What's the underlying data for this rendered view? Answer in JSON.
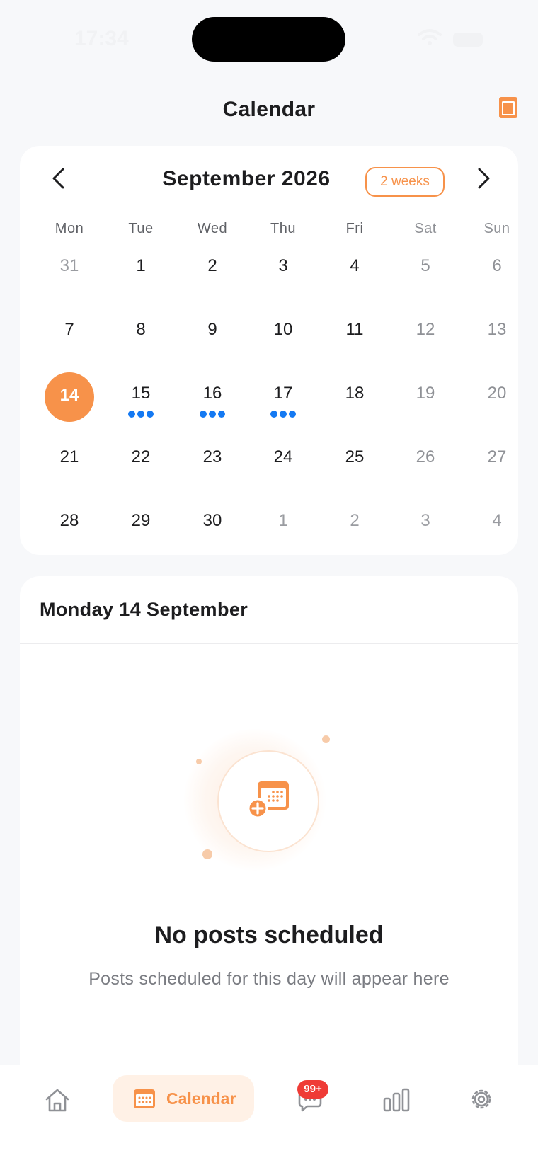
{
  "status_bar": {
    "time": "17:34"
  },
  "header": {
    "title": "Calendar",
    "action_icon": "calendar-view-icon"
  },
  "calendar": {
    "month_title": "September 2026",
    "range_label": "2 weeks",
    "weekdays": [
      "Mon",
      "Tue",
      "Wed",
      "Thu",
      "Fri",
      "Sat",
      "Sun"
    ],
    "weeks": [
      [
        "31",
        "1",
        "2",
        "3",
        "4",
        "5",
        "6"
      ],
      [
        "7",
        "8",
        "9",
        "10",
        "11",
        "12",
        "13"
      ],
      [
        "14",
        "15",
        "16",
        "17",
        "18",
        "19",
        "20"
      ],
      [
        "21",
        "22",
        "23",
        "24",
        "25",
        "26",
        "27"
      ],
      [
        "28",
        "29",
        "30",
        "1",
        "2",
        "3",
        "4"
      ]
    ],
    "selected_day": "14",
    "days_with_posts": [
      "15",
      "16",
      "17"
    ],
    "accent_color": "#f7924a",
    "dot_color": "#1479f2"
  },
  "day_panel": {
    "title": "Monday 14 September",
    "empty_icon": "calendar-add-icon",
    "empty_title": "No posts scheduled",
    "empty_subtitle": "Posts scheduled for this day will appear here"
  },
  "tab_bar": {
    "home_icon": "home-icon",
    "calendar_label": "Calendar",
    "messages_badge": "99+",
    "stats_icon": "bar-chart-icon",
    "settings_icon": "gear-icon"
  }
}
